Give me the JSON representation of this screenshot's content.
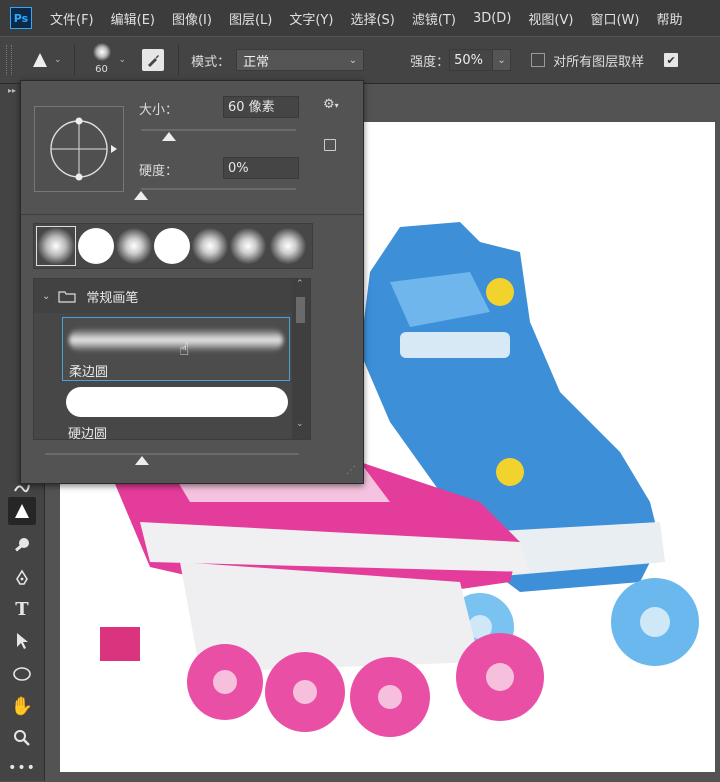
{
  "menu": {
    "logo": "Ps",
    "items": [
      "文件(F)",
      "编辑(E)",
      "图像(I)",
      "图层(L)",
      "文字(Y)",
      "选择(S)",
      "滤镜(T)",
      "3D(D)",
      "视图(V)",
      "窗口(W)",
      "帮助"
    ]
  },
  "options": {
    "brush_size": "60",
    "mode_label": "模式：",
    "mode_value": "正常",
    "strength_label": "强度：",
    "strength_value": "50%",
    "sample_all_label": "对所有图层取样"
  },
  "brush_panel": {
    "size_label": "大小：",
    "size_value": "60 像素",
    "size_slider": 0.18,
    "hardness_label": "硬度：",
    "hardness_value": "0%",
    "hardness_slider": 0.0,
    "group_name": "常规画笔",
    "brushes": [
      {
        "name": "柔边圆"
      },
      {
        "name": "硬边圆"
      }
    ]
  },
  "colors": {
    "ps_blue": "#31a8ff",
    "selection": "#4aa3d8"
  }
}
